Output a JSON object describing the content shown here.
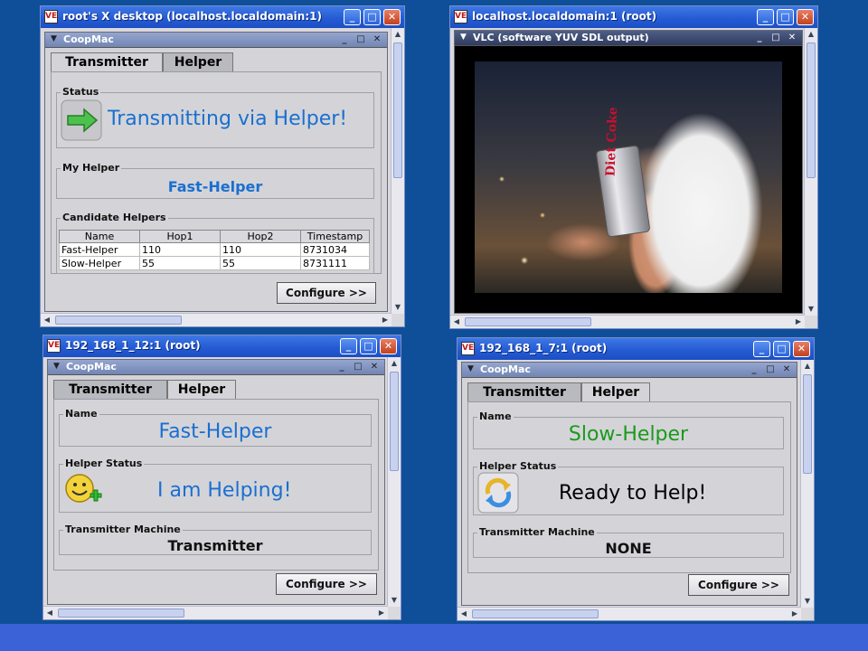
{
  "vnc_icon_text": "VE",
  "windows": {
    "top_left": {
      "title": "root's X desktop (localhost.localdomain:1)",
      "app_title": "CoopMac",
      "tabs": [
        "Transmitter",
        "Helper"
      ],
      "active_tab": "Transmitter",
      "status": {
        "label": "Status",
        "text": "Transmitting via Helper!",
        "icon": "arrow-right-icon"
      },
      "my_helper": {
        "label": "My Helper",
        "value": "Fast-Helper"
      },
      "candidates": {
        "label": "Candidate Helpers",
        "columns": [
          "Name",
          "Hop1",
          "Hop2",
          "Timestamp"
        ],
        "rows": [
          [
            "Fast-Helper",
            "110",
            "110",
            "8731034"
          ],
          [
            "Slow-Helper",
            "55",
            "55",
            "8731111"
          ]
        ]
      },
      "configure_label": "Configure >>"
    },
    "top_right": {
      "title": "localhost.localdomain:1 (root)",
      "vlc_title": "VLC (software YUV SDL output)",
      "video_brand": "Diet Coke"
    },
    "bottom_left": {
      "title": "192_168_1_12:1 (root)",
      "app_title": "CoopMac",
      "tabs": [
        "Transmitter",
        "Helper"
      ],
      "active_tab": "Helper",
      "name": {
        "label": "Name",
        "value": "Fast-Helper"
      },
      "helper_status": {
        "label": "Helper Status",
        "value": "I am Helping!",
        "icon": "smiley-plus-icon"
      },
      "transmitter_machine": {
        "label": "Transmitter Machine",
        "value": "Transmitter"
      },
      "configure_label": "Configure >>"
    },
    "bottom_right": {
      "title": "192_168_1_7:1 (root)",
      "app_title": "CoopMac",
      "tabs": [
        "Transmitter",
        "Helper"
      ],
      "active_tab": "Helper",
      "name": {
        "label": "Name",
        "value": "Slow-Helper"
      },
      "helper_status": {
        "label": "Helper Status",
        "value": "Ready to Help!",
        "icon": "refresh-arrows-icon"
      },
      "transmitter_machine": {
        "label": "Transmitter Machine",
        "value": "NONE"
      },
      "configure_label": "Configure >>"
    }
  },
  "colors": {
    "desktop": "#0f4f99",
    "blue_text": "#1a6fd0",
    "green_text": "#1a9a1a"
  }
}
